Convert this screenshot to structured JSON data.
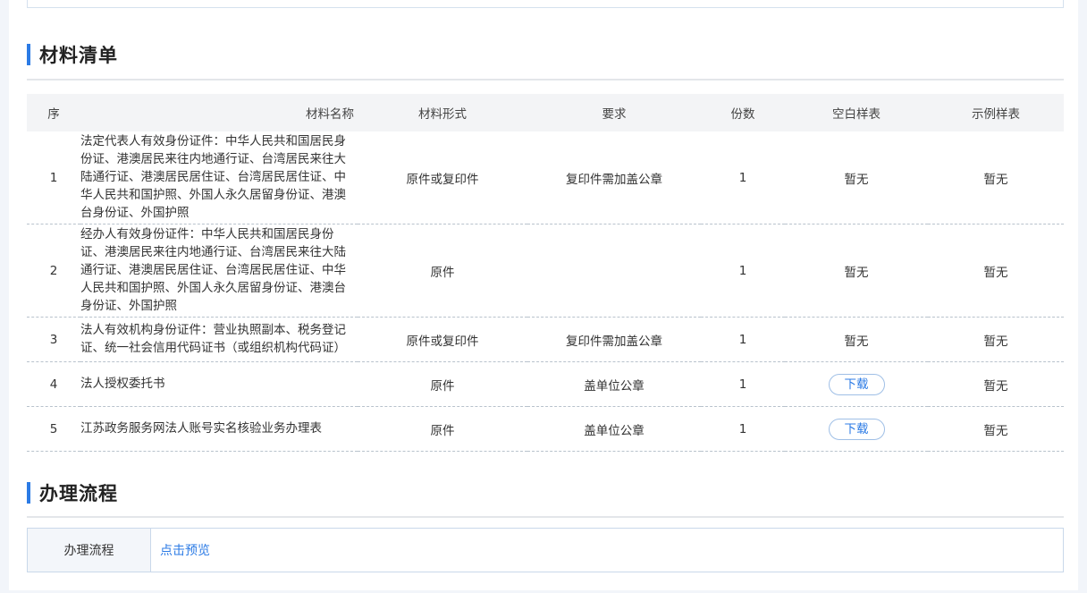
{
  "materials_section": {
    "title": "材料清单",
    "columns": [
      "序",
      "材料名称",
      "材料形式",
      "要求",
      "份数",
      "空白样表",
      "示例样表"
    ],
    "rows": [
      {
        "index": "1",
        "name": "法定代表人有效身份证件：中华人民共和国居民身份证、港澳居民来往内地通行证、台湾居民来往大陆通行证、港澳居民居住证、台湾居民居住证、中华人民共和国护照、外国人永久居留身份证、港澳台身份证、外国护照",
        "form": "原件或复印件",
        "requirement": "复印件需加盖公章",
        "copies": "1",
        "blank_sample": "暂无",
        "example_sample": "暂无"
      },
      {
        "index": "2",
        "name": "经办人有效身份证件：中华人民共和国居民身份证、港澳居民来往内地通行证、台湾居民来往大陆通行证、港澳居民居住证、台湾居民居住证、中华人民共和国护照、外国人永久居留身份证、港澳台身份证、外国护照",
        "form": "原件",
        "requirement": "",
        "copies": "1",
        "blank_sample": "暂无",
        "example_sample": "暂无"
      },
      {
        "index": "3",
        "name": "法人有效机构身份证件：营业执照副本、税务登记证、统一社会信用代码证书（或组织机构代码证）",
        "form": "原件或复印件",
        "requirement": "复印件需加盖公章",
        "copies": "1",
        "blank_sample": "暂无",
        "example_sample": "暂无"
      },
      {
        "index": "4",
        "name": "法人授权委托书",
        "form": "原件",
        "requirement": "盖单位公章",
        "copies": "1",
        "blank_sample": "下载",
        "example_sample": "暂无"
      },
      {
        "index": "5",
        "name": "江苏政务服务网法人账号实名核验业务办理表",
        "form": "原件",
        "requirement": "盖单位公章",
        "copies": "1",
        "blank_sample": "下载",
        "example_sample": "暂无"
      }
    ]
  },
  "process_section": {
    "title": "办理流程",
    "label": "办理流程",
    "link_text": "点击预览"
  },
  "colors": {
    "accent": "#2c7be5",
    "header_bg": "#f3f4f6",
    "page_bg": "#f2f5fa"
  }
}
